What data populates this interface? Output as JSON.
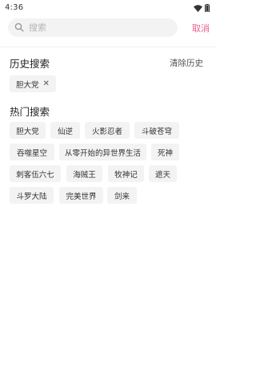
{
  "status_bar": {
    "time": "4:36"
  },
  "search": {
    "placeholder": "搜索",
    "value": "",
    "cancel_label": "取消"
  },
  "history": {
    "title": "历史搜索",
    "clear_label": "清除历史",
    "items": [
      "胆大党"
    ]
  },
  "hot": {
    "title": "热门搜索",
    "items": [
      "胆大党",
      "仙逆",
      "火影忍者",
      "斗破苍穹",
      "吞噬星空",
      "从零开始的异世界生活",
      "死神",
      "刺客伍六七",
      "海贼王",
      "牧神记",
      "遮天",
      "斗罗大陆",
      "完美世界",
      "剑来"
    ]
  },
  "colors": {
    "accent": "#ec5f8c",
    "chip_bg": "#f3f3f3",
    "search_bg": "#f3f3f3"
  }
}
